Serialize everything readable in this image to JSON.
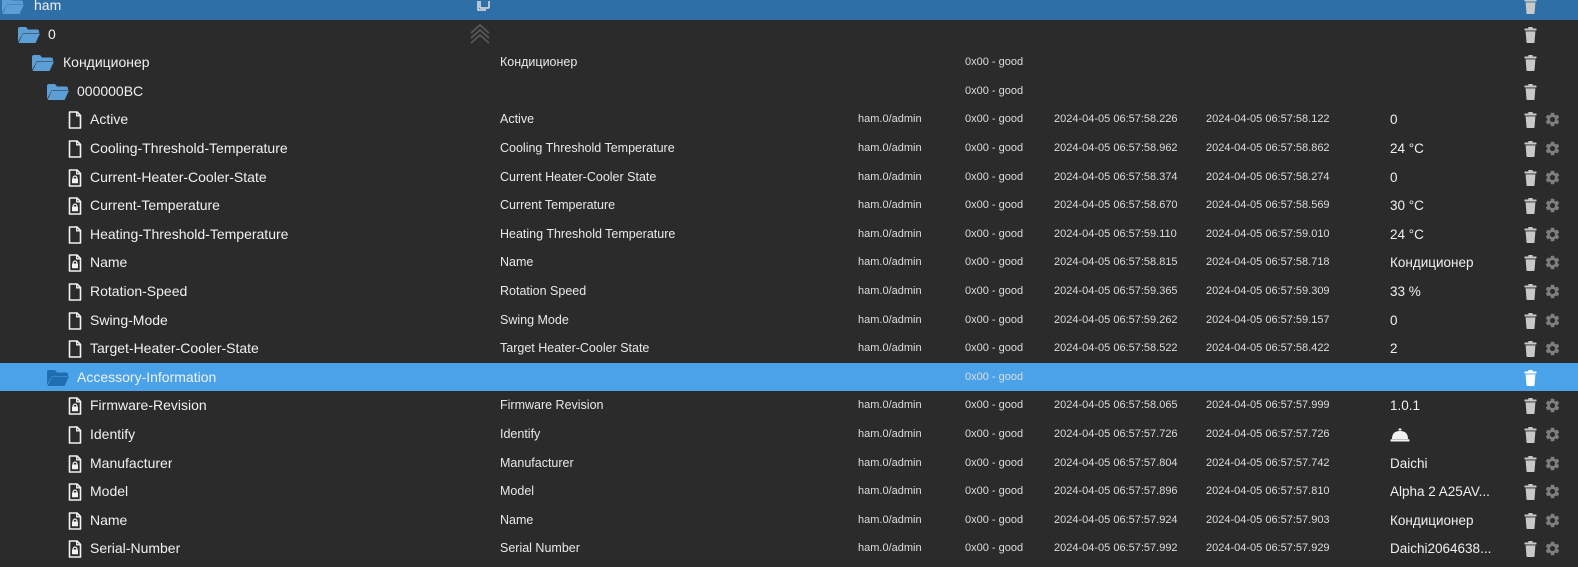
{
  "colors": {
    "background": "#2b2b2b",
    "selected_top": "#2f6fa8",
    "selected_row": "#4aa3e8",
    "folder": "#5b9fd6",
    "text": "#e6e6e6",
    "icon_gray": "#8a8a8a"
  },
  "icons": {
    "folder": "folder-open-icon",
    "file": "file-icon",
    "locked_file": "file-lock-icon",
    "delete": "trash-icon",
    "settings": "gear-icon",
    "copy": "copy-icon",
    "collapse": "collapse-icon"
  },
  "rows": [
    {
      "type": "folder",
      "level": 0,
      "name": "ham",
      "desc": "",
      "role": "",
      "quality": "",
      "ts": "",
      "lc": "",
      "value": "",
      "gear": false,
      "style": "sel-dark"
    },
    {
      "type": "folder",
      "level": 1,
      "name": "0",
      "desc": "",
      "role": "",
      "quality": "",
      "ts": "",
      "lc": "",
      "value": "",
      "gear": false,
      "style": ""
    },
    {
      "type": "folder",
      "level": 2,
      "name": "Кондиционер",
      "desc": "Кондиционер",
      "role": "",
      "quality": "0x00 - good",
      "ts": "",
      "lc": "",
      "value": "",
      "gear": false,
      "style": ""
    },
    {
      "type": "folder",
      "level": 3,
      "name": "000000BC",
      "desc": "",
      "role": "",
      "quality": "0x00 - good",
      "ts": "",
      "lc": "",
      "value": "",
      "gear": false,
      "style": ""
    },
    {
      "type": "file",
      "level": 4,
      "name": "Active",
      "desc": "Active",
      "role": "ham.0/admin",
      "quality": "0x00 - good",
      "ts": "2024-04-05 06:57:58.226",
      "lc": "2024-04-05 06:57:58.122",
      "value": "0",
      "gear": true,
      "style": ""
    },
    {
      "type": "file",
      "level": 4,
      "name": "Cooling-Threshold-Temperature",
      "desc": "Cooling Threshold Temperature",
      "role": "ham.0/admin",
      "quality": "0x00 - good",
      "ts": "2024-04-05 06:57:58.962",
      "lc": "2024-04-05 06:57:58.862",
      "value": "24 °C",
      "gear": true,
      "style": ""
    },
    {
      "type": "locked",
      "level": 4,
      "name": "Current-Heater-Cooler-State",
      "desc": "Current Heater-Cooler State",
      "role": "ham.0/admin",
      "quality": "0x00 - good",
      "ts": "2024-04-05 06:57:58.374",
      "lc": "2024-04-05 06:57:58.274",
      "value": "0",
      "gear": true,
      "style": ""
    },
    {
      "type": "locked",
      "level": 4,
      "name": "Current-Temperature",
      "desc": "Current Temperature",
      "role": "ham.0/admin",
      "quality": "0x00 - good",
      "ts": "2024-04-05 06:57:58.670",
      "lc": "2024-04-05 06:57:58.569",
      "value": "30 °C",
      "gear": true,
      "style": ""
    },
    {
      "type": "file",
      "level": 4,
      "name": "Heating-Threshold-Temperature",
      "desc": "Heating Threshold Temperature",
      "role": "ham.0/admin",
      "quality": "0x00 - good",
      "ts": "2024-04-05 06:57:59.110",
      "lc": "2024-04-05 06:57:59.010",
      "value": "24 °C",
      "gear": true,
      "style": ""
    },
    {
      "type": "locked",
      "level": 4,
      "name": "Name",
      "desc": "Name",
      "role": "ham.0/admin",
      "quality": "0x00 - good",
      "ts": "2024-04-05 06:57:58.815",
      "lc": "2024-04-05 06:57:58.718",
      "value": "Кондиционер",
      "gear": true,
      "style": ""
    },
    {
      "type": "file",
      "level": 4,
      "name": "Rotation-Speed",
      "desc": "Rotation Speed",
      "role": "ham.0/admin",
      "quality": "0x00 - good",
      "ts": "2024-04-05 06:57:59.365",
      "lc": "2024-04-05 06:57:59.309",
      "value": "33 %",
      "gear": true,
      "style": ""
    },
    {
      "type": "file",
      "level": 4,
      "name": "Swing-Mode",
      "desc": "Swing Mode",
      "role": "ham.0/admin",
      "quality": "0x00 - good",
      "ts": "2024-04-05 06:57:59.262",
      "lc": "2024-04-05 06:57:59.157",
      "value": "0",
      "gear": true,
      "style": ""
    },
    {
      "type": "file",
      "level": 4,
      "name": "Target-Heater-Cooler-State",
      "desc": "Target Heater-Cooler State",
      "role": "ham.0/admin",
      "quality": "0x00 - good",
      "ts": "2024-04-05 06:57:58.522",
      "lc": "2024-04-05 06:57:58.422",
      "value": "2",
      "gear": true,
      "style": ""
    },
    {
      "type": "folder",
      "level": 3,
      "name": "Accessory-Information",
      "desc": "",
      "role": "",
      "quality": "0x00 - good",
      "ts": "",
      "lc": "",
      "value": "",
      "gear": false,
      "style": "sel-light"
    },
    {
      "type": "locked",
      "level": 4,
      "name": "Firmware-Revision",
      "desc": "Firmware Revision",
      "role": "ham.0/admin",
      "quality": "0x00 - good",
      "ts": "2024-04-05 06:57:58.065",
      "lc": "2024-04-05 06:57:57.999",
      "value": "1.0.1",
      "gear": true,
      "style": ""
    },
    {
      "type": "file",
      "level": 4,
      "name": "Identify",
      "desc": "Identify",
      "role": "ham.0/admin",
      "quality": "0x00 - good",
      "ts": "2024-04-05 06:57:57.726",
      "lc": "2024-04-05 06:57:57.726",
      "value": "",
      "bell": true,
      "gear": true,
      "style": ""
    },
    {
      "type": "locked",
      "level": 4,
      "name": "Manufacturer",
      "desc": "Manufacturer",
      "role": "ham.0/admin",
      "quality": "0x00 - good",
      "ts": "2024-04-05 06:57:57.804",
      "lc": "2024-04-05 06:57:57.742",
      "value": "Daichi",
      "gear": true,
      "style": ""
    },
    {
      "type": "locked",
      "level": 4,
      "name": "Model",
      "desc": "Model",
      "role": "ham.0/admin",
      "quality": "0x00 - good",
      "ts": "2024-04-05 06:57:57.896",
      "lc": "2024-04-05 06:57:57.810",
      "value": "Alpha 2 A25AV...",
      "gear": true,
      "style": ""
    },
    {
      "type": "locked",
      "level": 4,
      "name": "Name",
      "desc": "Name",
      "role": "ham.0/admin",
      "quality": "0x00 - good",
      "ts": "2024-04-05 06:57:57.924",
      "lc": "2024-04-05 06:57:57.903",
      "value": "Кондиционер",
      "gear": true,
      "style": ""
    },
    {
      "type": "locked",
      "level": 4,
      "name": "Serial-Number",
      "desc": "Serial Number",
      "role": "ham.0/admin",
      "quality": "0x00 - good",
      "ts": "2024-04-05 06:57:57.992",
      "lc": "2024-04-05 06:57:57.929",
      "value": "Daichi2064638...",
      "gear": true,
      "style": ""
    }
  ]
}
